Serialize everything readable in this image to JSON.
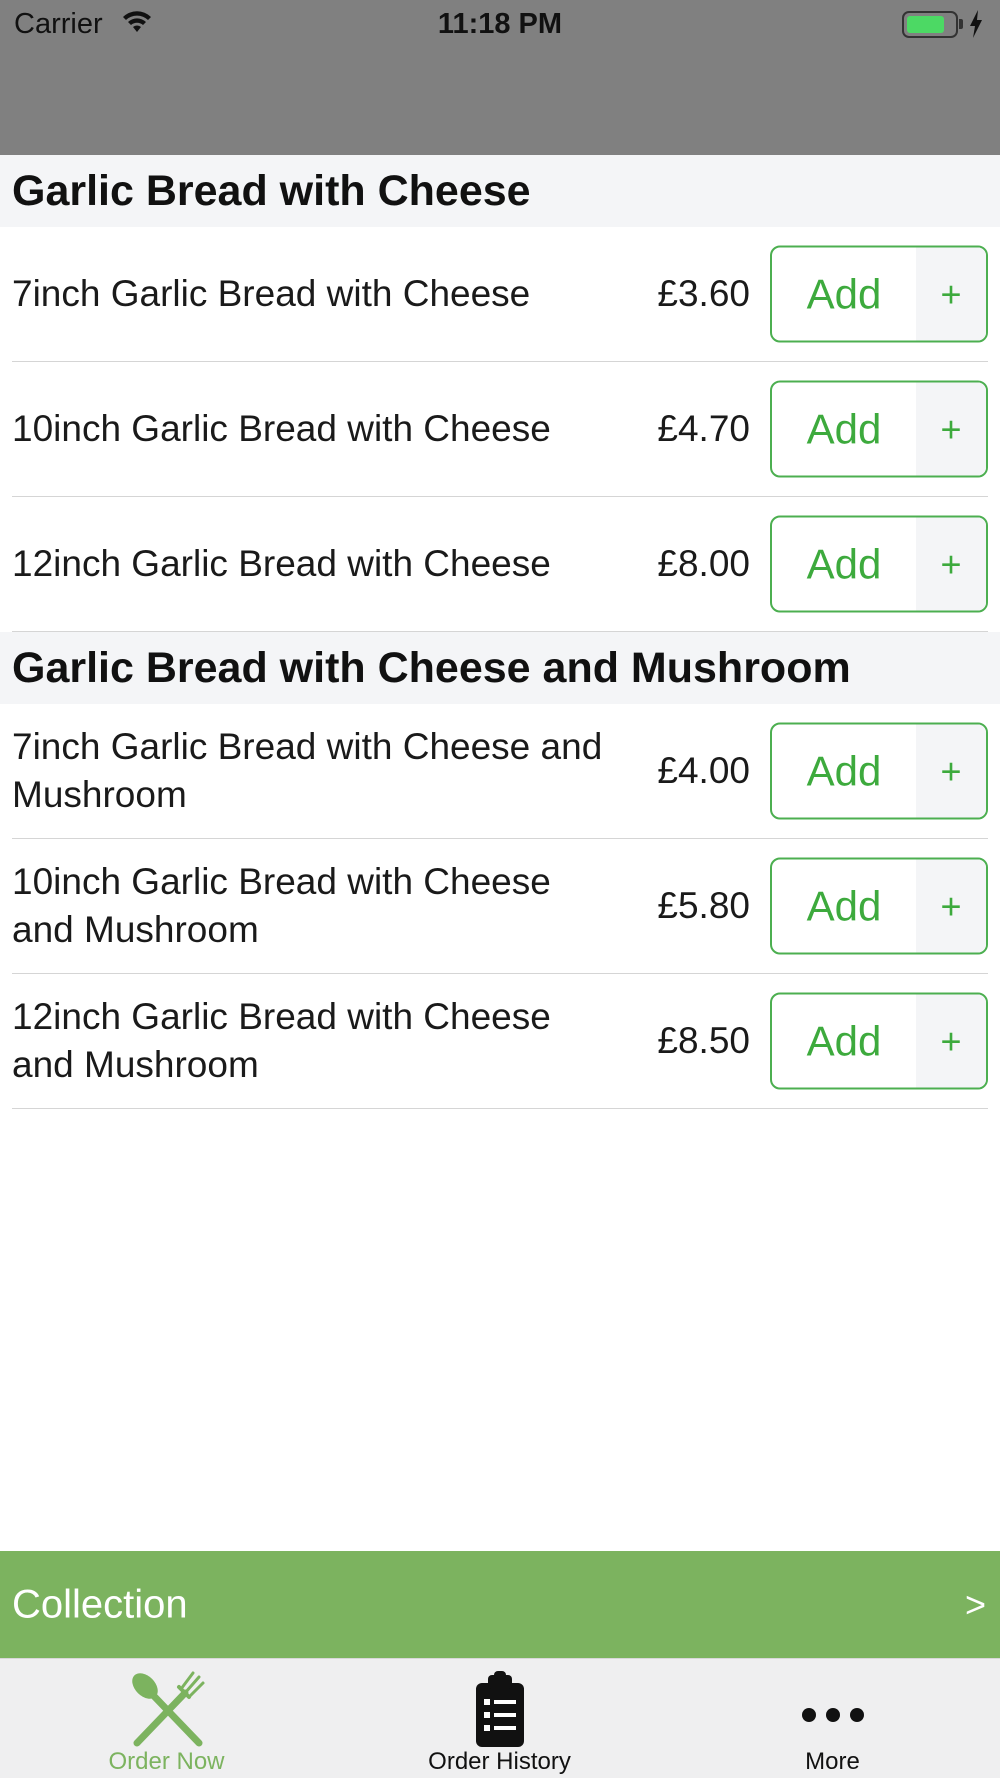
{
  "status_bar": {
    "carrier": "Carrier",
    "time": "11:18 PM",
    "battery_level": 0.8
  },
  "menu": {
    "sections": [
      {
        "title": "Garlic Bread with Cheese",
        "items": [
          {
            "name": "7inch Garlic Bread with Cheese",
            "price": "£3.60"
          },
          {
            "name": "10inch Garlic Bread with Cheese",
            "price": "£4.70"
          },
          {
            "name": "12inch Garlic Bread with Cheese",
            "price": "£8.00"
          }
        ]
      },
      {
        "title": "Garlic Bread with Cheese and Mushroom",
        "items": [
          {
            "name": "7inch Garlic Bread with Cheese and Mushroom",
            "price": "£4.00"
          },
          {
            "name": "10inch Garlic Bread with Cheese and Mushroom",
            "price": "£5.80"
          },
          {
            "name": "12inch Garlic Bread with Cheese and Mushroom",
            "price": "£8.50"
          }
        ]
      }
    ],
    "add_label": "Add",
    "plus_label": "+"
  },
  "collection_bar": {
    "label": "Collection",
    "arrow": ">"
  },
  "tab_bar": {
    "tabs": [
      {
        "label": "Order Now",
        "icon": "fork-knife-icon",
        "active": true
      },
      {
        "label": "Order History",
        "icon": "clipboard-list-icon",
        "active": false
      },
      {
        "label": "More",
        "icon": "more-dots-icon",
        "active": false
      }
    ]
  },
  "colors": {
    "accent_green": "#7cb35f",
    "button_green": "#3daa3d",
    "nav_gray": "#808080"
  }
}
